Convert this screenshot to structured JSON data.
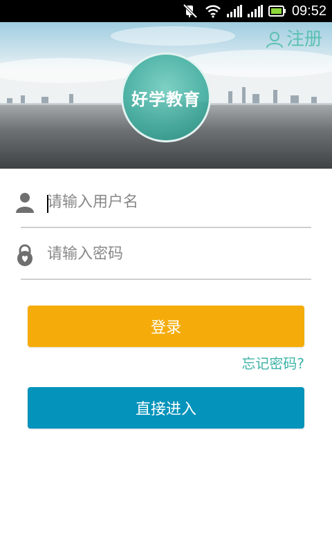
{
  "status_bar": {
    "time": "09:52",
    "icons": [
      "mute-icon",
      "wifi-icon",
      "signal-icon",
      "signal-icon",
      "battery-icon"
    ]
  },
  "banner": {
    "register_label": "注册",
    "register_icon": "person-outline-icon",
    "logo_text": "好学教育"
  },
  "form": {
    "username_placeholder": "请输入用户名",
    "username_icon": "user-icon",
    "password_placeholder": "请输入密码",
    "password_icon": "lock-icon"
  },
  "actions": {
    "login_label": "登录",
    "forgot_label": "忘记密码?",
    "enter_label": "直接进入"
  },
  "colors": {
    "accent_teal": "#5cc0b3",
    "login_button": "#f5ac0a",
    "enter_button": "#0393bb",
    "divider": "#cfcfcf"
  }
}
